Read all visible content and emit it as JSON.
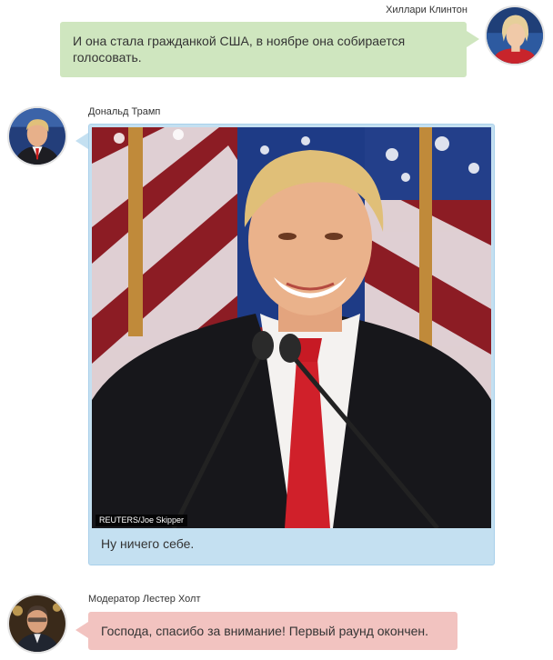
{
  "messages": [
    {
      "speaker": "Хиллари Клинтон",
      "text": "И она стала гражданкой США, в ноябре она собирается голосовать.",
      "bubble_color": "#cfe6bf",
      "side": "right",
      "avatar_icon": "avatar-portrait-icon"
    },
    {
      "speaker": "Дональд Трамп",
      "text": "Ну ничего себе.",
      "photo_credit": "REUTERS/Joe Skipper",
      "bubble_color": "#c4e0f1",
      "side": "left",
      "avatar_icon": "avatar-portrait-icon"
    },
    {
      "speaker": "Модератор Лестер Холт",
      "text": "Господа, спасибо за внимание! Первый раунд окончен.",
      "bubble_color": "#f2c3c0",
      "side": "left",
      "avatar_icon": "avatar-portrait-icon"
    }
  ]
}
